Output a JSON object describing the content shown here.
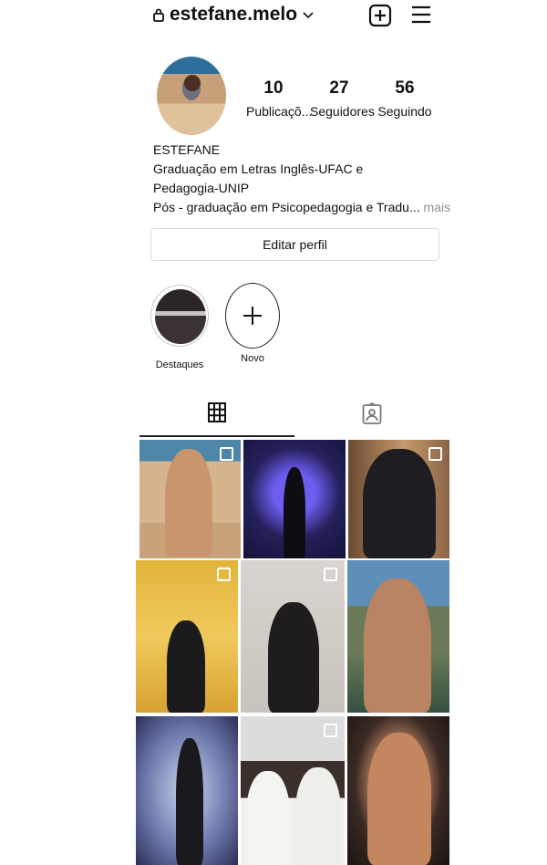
{
  "header": {
    "username": "estefane.melo"
  },
  "profile": {
    "stats": [
      {
        "value": "10",
        "label": "Publicaçõ..."
      },
      {
        "value": "27",
        "label": "Seguidores"
      },
      {
        "value": "56",
        "label": "Seguindo"
      }
    ],
    "name": "ESTEFANE",
    "bio_lines": [
      "Graduação em Letras Inglês-UFAC e",
      "Pedagogia-UNIP",
      "Pós - graduação em Psicopedagogia e Tradu..."
    ],
    "more": "mais",
    "edit_button": "Editar perfil"
  },
  "highlights": [
    {
      "label": "Destaques"
    },
    {
      "label": "Novo"
    }
  ],
  "tabs": {
    "active": "grid"
  },
  "posts_count_visible": 9
}
